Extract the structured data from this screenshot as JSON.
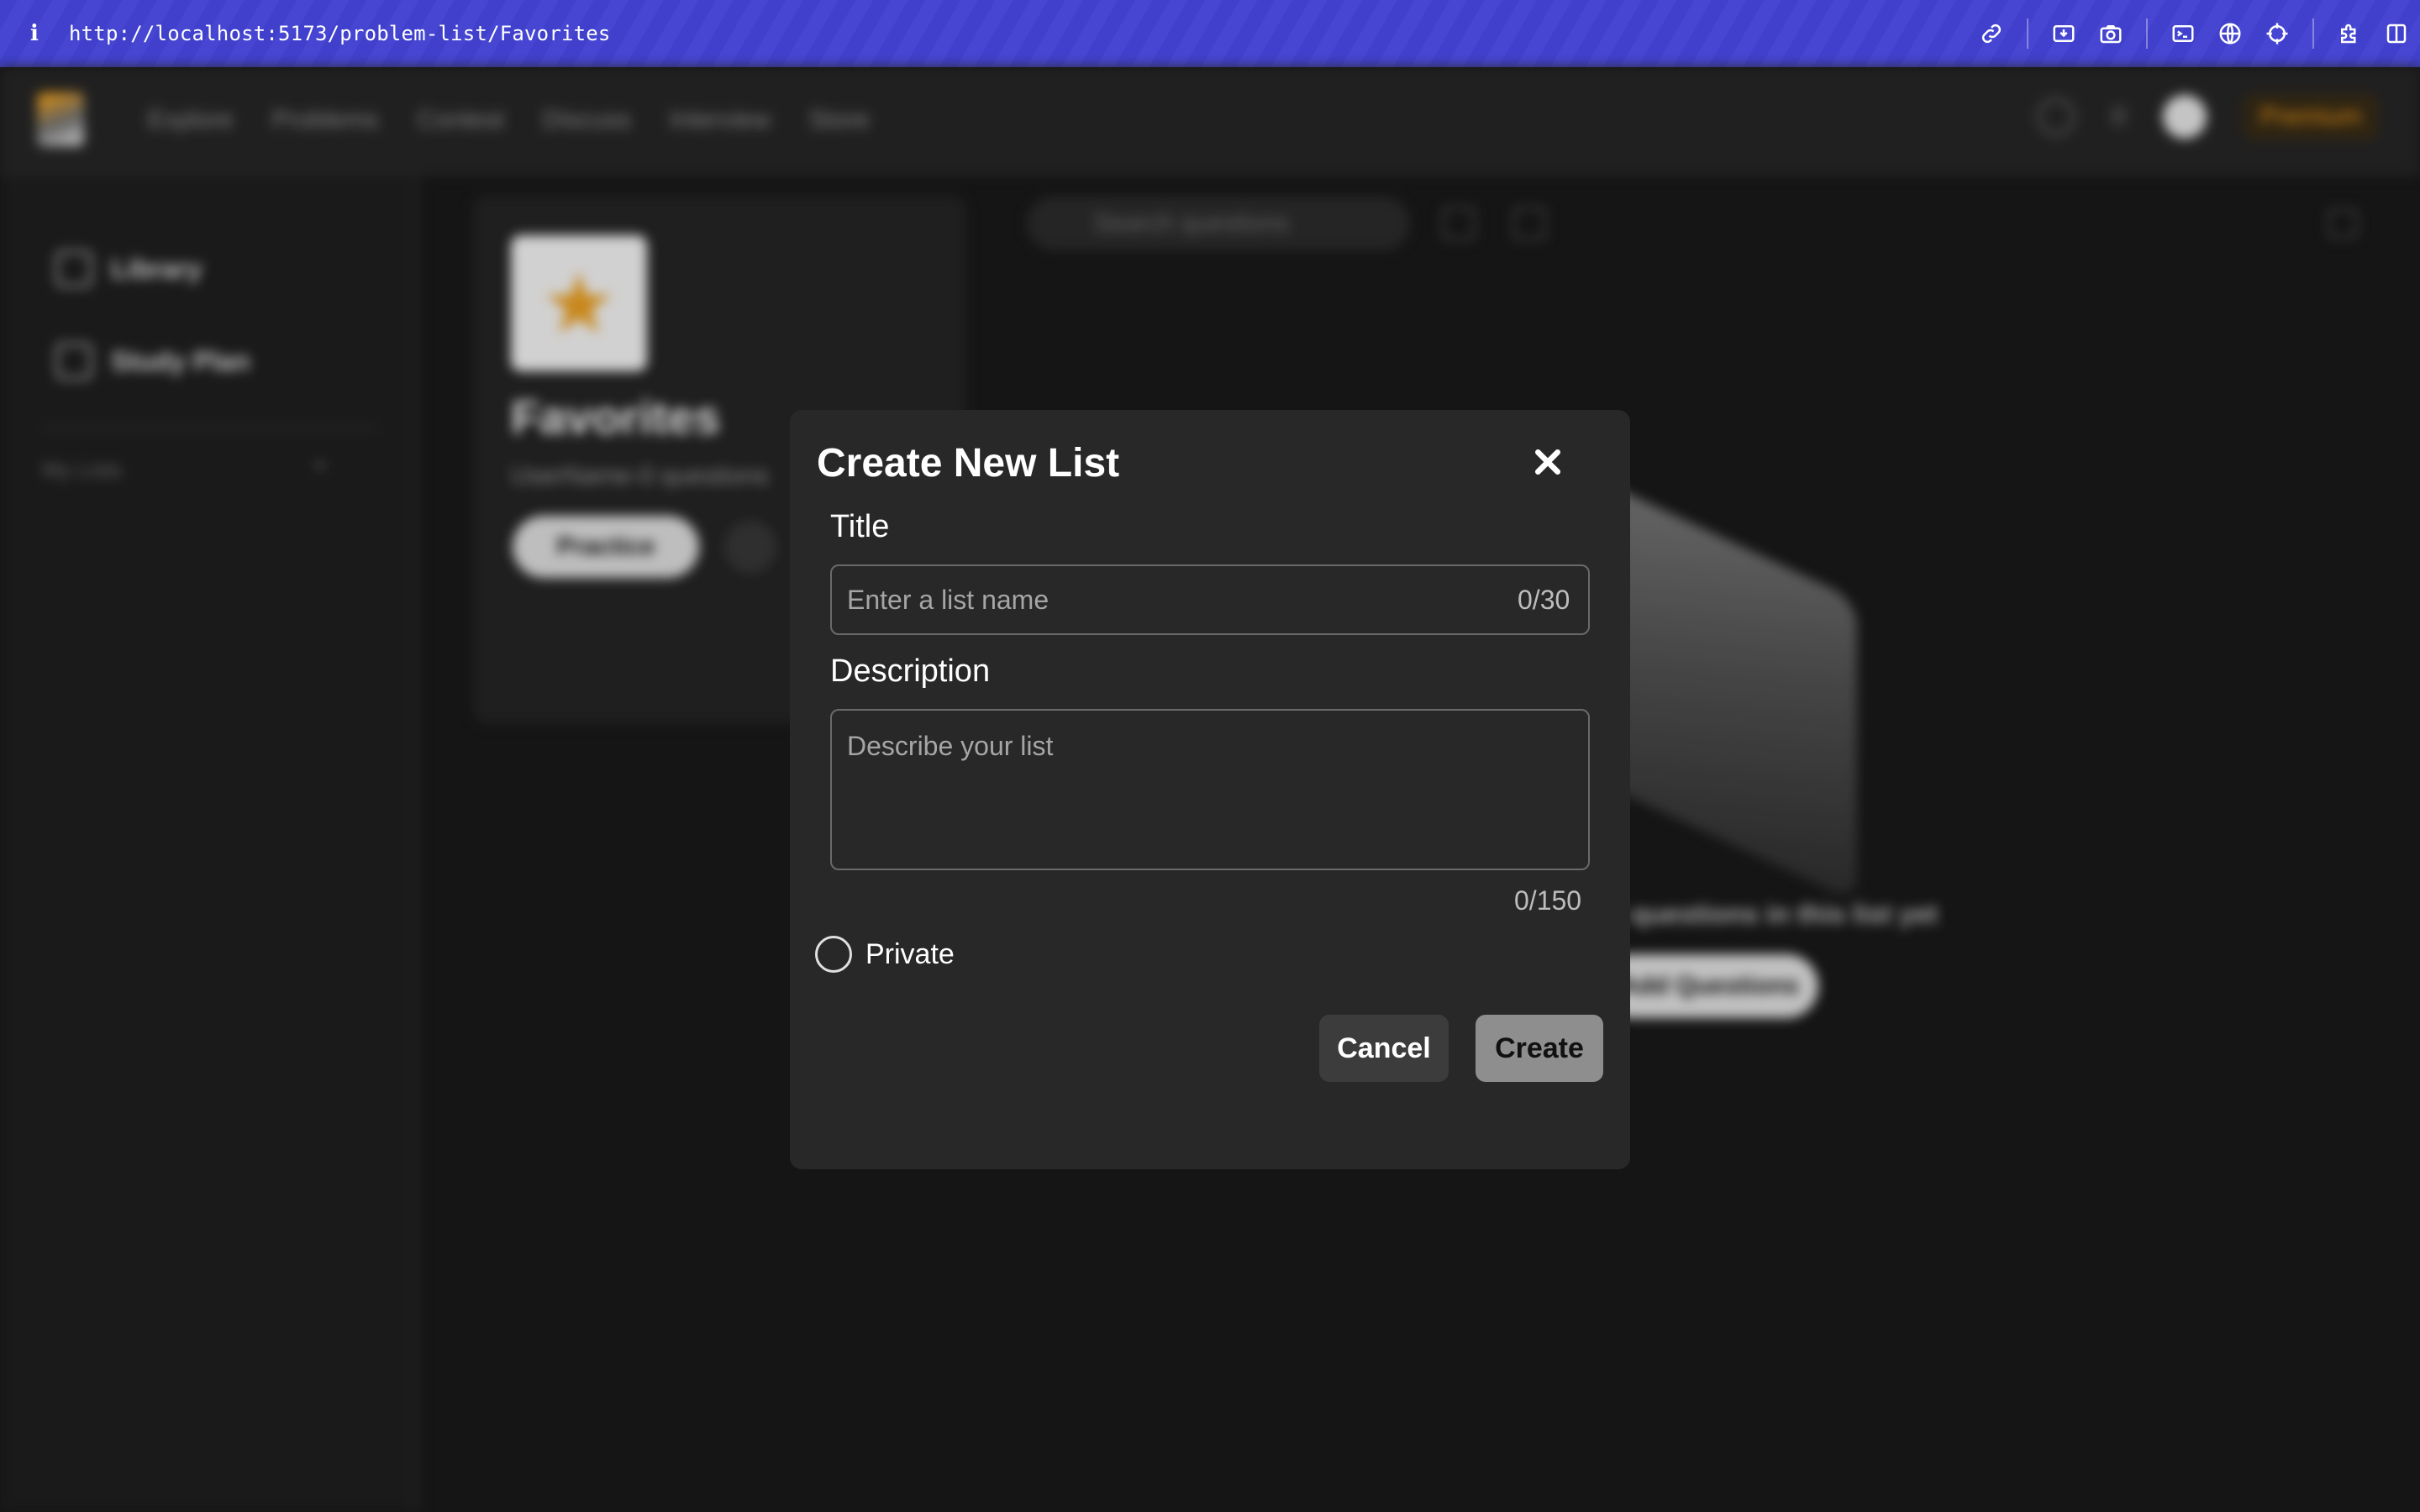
{
  "browser": {
    "info_icon": "i",
    "url": "http://localhost:5173/problem-list/Favorites",
    "toolbar_icons": [
      "link-icon",
      "download-icon",
      "camera-icon",
      "terminal-icon",
      "globe-icon",
      "crosshair-icon",
      "extension-icon",
      "split-view-icon"
    ],
    "accent": "#4040cc"
  },
  "background": {
    "nav": {
      "links": [
        "Explore",
        "Problems",
        "Contest",
        "Discuss",
        "Interview",
        "Store"
      ],
      "premium_label": "Premium",
      "streak": "0"
    },
    "sidebar": {
      "items": [
        {
          "label": "Library",
          "icon": "library-icon"
        },
        {
          "label": "Study Plan",
          "icon": "study-plan-icon"
        }
      ],
      "my_lists_label": "My Lists"
    },
    "favorites_card": {
      "title": "Favorites",
      "subtitle": "UserName-0 questions",
      "practice_label": "Practice",
      "icon": "star-icon",
      "icon_color": "#f5a623"
    },
    "search_placeholder": "Search questions",
    "empty_state_text": "No questions in this list yet",
    "add_questions_label": "Add Questions"
  },
  "modal": {
    "title": "Create New List",
    "title_label": "Title",
    "title_placeholder": "Enter a list name",
    "title_counter": "0/30",
    "description_label": "Description",
    "description_placeholder": "Describe your list",
    "description_counter": "0/150",
    "private_label": "Private",
    "cancel_label": "Cancel",
    "create_label": "Create"
  }
}
